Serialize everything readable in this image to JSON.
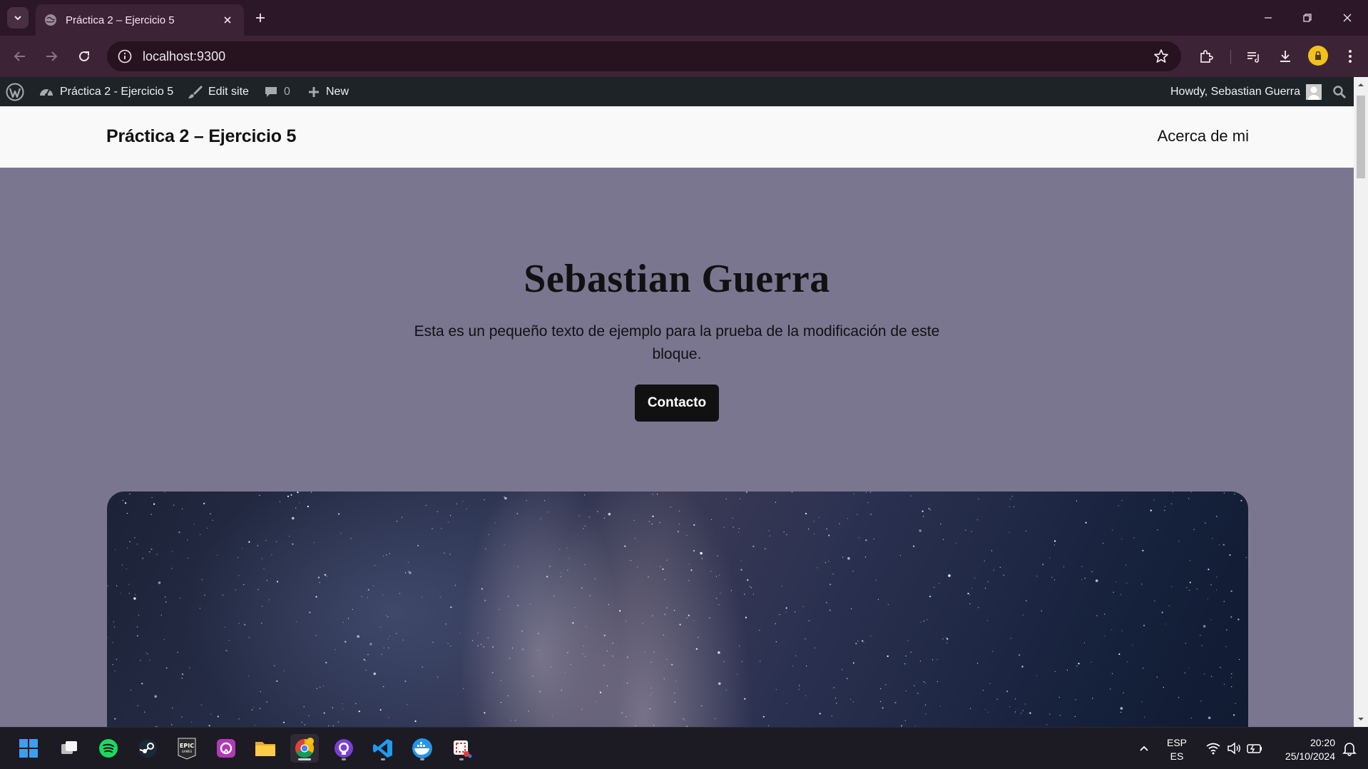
{
  "browser": {
    "tab_title": "Práctica 2 – Ejercicio 5",
    "url": "localhost:9300"
  },
  "adminbar": {
    "site_name": "Práctica 2 - Ejercicio 5",
    "edit_site": "Edit site",
    "comments_count": "0",
    "new_label": "New",
    "howdy": "Howdy, Sebastian Guerra"
  },
  "site": {
    "title": "Práctica 2 – Ejercicio 5",
    "nav_link": "Acerca de mi"
  },
  "hero": {
    "heading": "Sebastian Guerra",
    "text": "Esta es un pequeño texto de ejemplo para la prueba de la modificación de este bloque.",
    "button": "Contacto"
  },
  "taskbar": {
    "lang_top": "ESP",
    "lang_bottom": "ES",
    "time": "20:20",
    "date": "25/10/2024",
    "apps": [
      "windows-start-icon",
      "task-view-icon",
      "spotify-icon",
      "steam-icon",
      "epic-games-icon",
      "aura-app-icon",
      "file-explorer-icon",
      "chrome-icon",
      "github-desktop-icon",
      "vscode-icon",
      "docker-icon",
      "snipping-tool-icon"
    ]
  },
  "colors": {
    "chrome_frame": "#2b1727",
    "chrome_toolbar": "#3d2336",
    "wp_adminbar": "#1d2327",
    "page_background": "#7b7690",
    "header_background": "#f9f9f9",
    "button_background": "#111111"
  }
}
